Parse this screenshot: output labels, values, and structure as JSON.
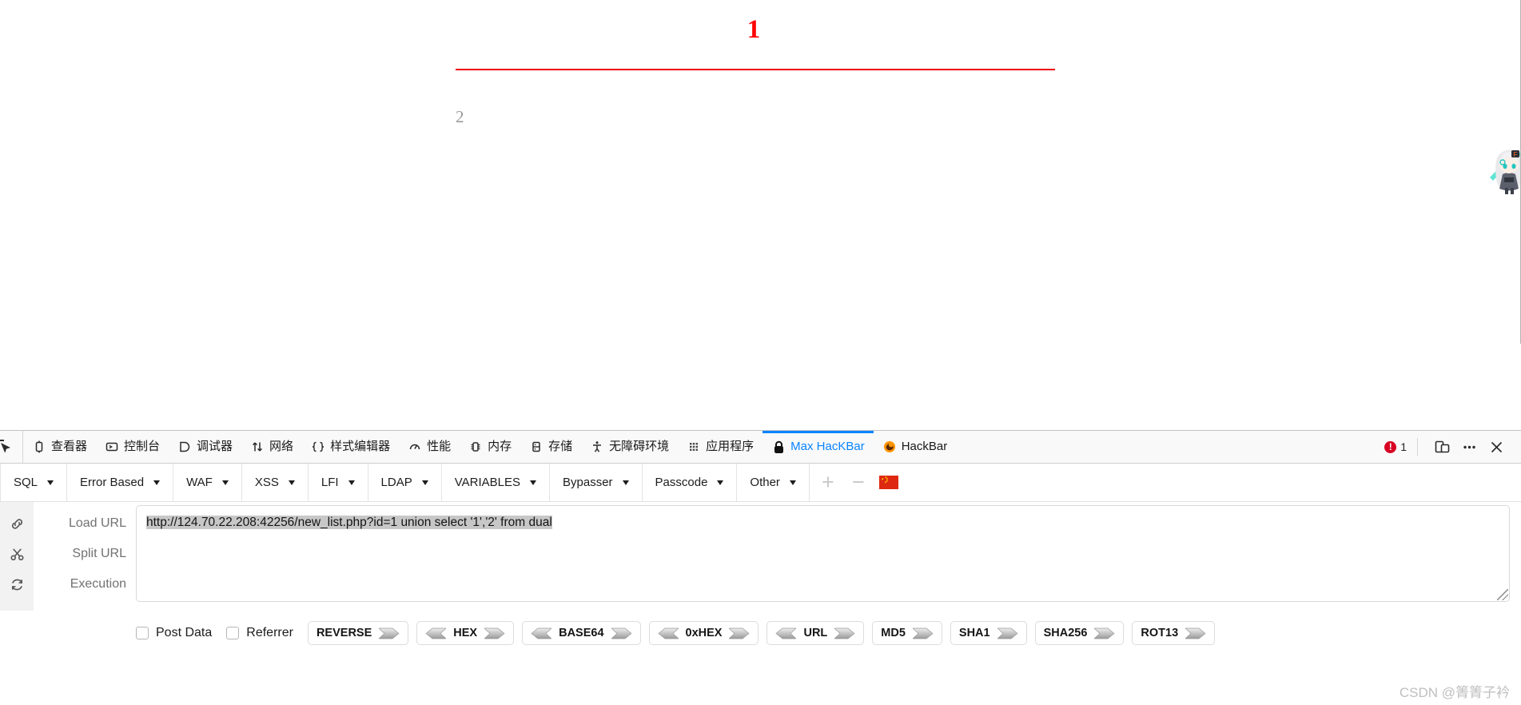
{
  "page": {
    "heading": "1",
    "secondary_text": "2",
    "heading_color": "#ff0000",
    "rule_color": "#ee0000",
    "secondary_color": "#9a9a9a",
    "sprite_name": "anime-character-sprite"
  },
  "devtools": {
    "picker_icon": "element-picker-icon",
    "tabs": [
      {
        "label": "查看器",
        "icon": "inspector-icon",
        "active": false
      },
      {
        "label": "控制台",
        "icon": "console-icon",
        "active": false
      },
      {
        "label": "调试器",
        "icon": "debugger-icon",
        "active": false
      },
      {
        "label": "网络",
        "icon": "network-icon",
        "active": false
      },
      {
        "label": "样式编辑器",
        "icon": "style-editor-icon",
        "active": false
      },
      {
        "label": "性能",
        "icon": "performance-icon",
        "active": false
      },
      {
        "label": "内存",
        "icon": "memory-icon",
        "active": false
      },
      {
        "label": "存储",
        "icon": "storage-icon",
        "active": false
      },
      {
        "label": "无障碍环境",
        "icon": "accessibility-icon",
        "active": false
      },
      {
        "label": "应用程序",
        "icon": "application-icon",
        "active": false
      },
      {
        "label": "Max HacKBar",
        "icon": "lock-icon",
        "active": true
      },
      {
        "label": "HackBar",
        "icon": "firefox-addon-icon",
        "active": false
      }
    ],
    "error_count": "1",
    "error_color": "#d70022",
    "active_tab_color": "#0a84ff",
    "responsive_icon": "responsive-design-mode-icon",
    "meny_icon": "more-options-icon",
    "close_icon": "close-icon"
  },
  "hackbar": {
    "payload_menus": [
      "SQL",
      "Error Based",
      "WAF",
      "XSS",
      "LFI",
      "LDAP",
      "VARIABLES",
      "Bypasser",
      "Passcode",
      "Other"
    ],
    "add_label": "+",
    "remove_label": "−",
    "flag_icon": "china-flag-icon",
    "actions": [
      {
        "label": "Load URL",
        "icon": "link-icon"
      },
      {
        "label": "Split URL",
        "icon": "scissors-icon"
      },
      {
        "label": "Execution",
        "icon": "refresh-icon"
      }
    ],
    "url_value": "http://124.70.22.208:42256/new_list.php?id=1 union select '1','2' from dual",
    "url_placeholder": "",
    "checkboxes": [
      {
        "label": "Post Data",
        "checked": false
      },
      {
        "label": "Referrer",
        "checked": false
      }
    ],
    "encoders": [
      {
        "label": "REVERSE",
        "left_arrow": false,
        "right_arrow": true
      },
      {
        "label": "HEX",
        "left_arrow": true,
        "right_arrow": true
      },
      {
        "label": "BASE64",
        "left_arrow": true,
        "right_arrow": true
      },
      {
        "label": "0xHEX",
        "left_arrow": true,
        "right_arrow": true
      },
      {
        "label": "URL",
        "left_arrow": true,
        "right_arrow": true
      },
      {
        "label": "MD5",
        "left_arrow": false,
        "right_arrow": true
      },
      {
        "label": "SHA1",
        "left_arrow": false,
        "right_arrow": true
      },
      {
        "label": "SHA256",
        "left_arrow": false,
        "right_arrow": true
      },
      {
        "label": "ROT13",
        "left_arrow": false,
        "right_arrow": true
      }
    ]
  },
  "watermark": "CSDN @箐箐子衿"
}
